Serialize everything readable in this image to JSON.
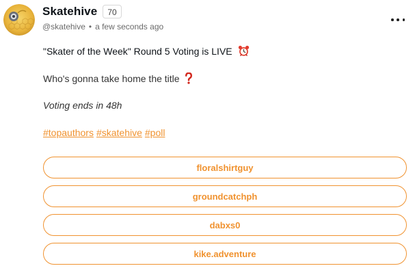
{
  "post": {
    "author": "Skatehive",
    "reputation": "70",
    "handle": "@skatehive",
    "separator": "•",
    "timestamp": "a few seconds ago",
    "more_icon": "more-horizontal-icon",
    "line1": "\"Skater of the Week\" Round 5 Voting is LIVE",
    "line1_icon": "alarm-clock-emoji",
    "line2": "Who's gonna take home the title",
    "line2_icon": "question-mark-emoji",
    "line3": "Voting ends in 48h",
    "tags": [
      "#topauthors",
      "#skatehive",
      "#poll"
    ]
  },
  "poll": {
    "accent_color": "#f0922f",
    "options": [
      "floralshirtguy",
      "groundcatchph",
      "dabxs0",
      "kike.adventure"
    ]
  }
}
